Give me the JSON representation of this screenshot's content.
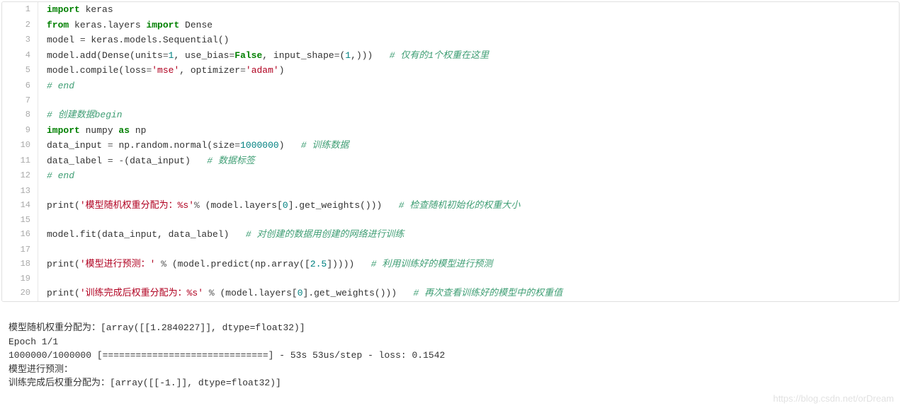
{
  "code": {
    "lines": [
      {
        "n": "1",
        "tokens": [
          {
            "t": "import",
            "c": "kw-green-bold"
          },
          {
            "t": " keras",
            "c": "name"
          }
        ]
      },
      {
        "n": "2",
        "tokens": [
          {
            "t": "from",
            "c": "kw-green-bold"
          },
          {
            "t": " keras.layers ",
            "c": "name"
          },
          {
            "t": "import",
            "c": "kw-green-bold"
          },
          {
            "t": " Dense",
            "c": "name"
          }
        ]
      },
      {
        "n": "3",
        "tokens": [
          {
            "t": "model ",
            "c": "name"
          },
          {
            "t": "=",
            "c": "operator"
          },
          {
            "t": " keras.models.Sequential()",
            "c": "name"
          }
        ]
      },
      {
        "n": "4",
        "tokens": [
          {
            "t": "model.add(Dense(units",
            "c": "name"
          },
          {
            "t": "=",
            "c": "operator"
          },
          {
            "t": "1",
            "c": "number"
          },
          {
            "t": ", use_bias",
            "c": "name"
          },
          {
            "t": "=",
            "c": "operator"
          },
          {
            "t": "False",
            "c": "bool"
          },
          {
            "t": ", input_shape",
            "c": "name"
          },
          {
            "t": "=",
            "c": "operator"
          },
          {
            "t": "(",
            "c": "name"
          },
          {
            "t": "1",
            "c": "number"
          },
          {
            "t": ",)))   ",
            "c": "name"
          },
          {
            "t": "# 仅有的1个权重在这里",
            "c": "comment"
          }
        ]
      },
      {
        "n": "5",
        "tokens": [
          {
            "t": "model.compile(loss",
            "c": "name"
          },
          {
            "t": "=",
            "c": "operator"
          },
          {
            "t": "'mse'",
            "c": "string-red"
          },
          {
            "t": ", optimizer",
            "c": "name"
          },
          {
            "t": "=",
            "c": "operator"
          },
          {
            "t": "'adam'",
            "c": "string-red"
          },
          {
            "t": ")",
            "c": "name"
          }
        ]
      },
      {
        "n": "6",
        "tokens": [
          {
            "t": "# end",
            "c": "comment"
          }
        ]
      },
      {
        "n": "7",
        "tokens": [
          {
            "t": "",
            "c": "name"
          }
        ]
      },
      {
        "n": "8",
        "tokens": [
          {
            "t": "# 创建数据begin",
            "c": "comment"
          }
        ]
      },
      {
        "n": "9",
        "tokens": [
          {
            "t": "import",
            "c": "kw-green-bold"
          },
          {
            "t": " numpy ",
            "c": "name"
          },
          {
            "t": "as",
            "c": "kw-green-bold"
          },
          {
            "t": " np",
            "c": "name"
          }
        ]
      },
      {
        "n": "10",
        "tokens": [
          {
            "t": "data_input ",
            "c": "name"
          },
          {
            "t": "=",
            "c": "operator"
          },
          {
            "t": " np.random.normal(size",
            "c": "name"
          },
          {
            "t": "=",
            "c": "operator"
          },
          {
            "t": "1000000",
            "c": "number"
          },
          {
            "t": ")   ",
            "c": "name"
          },
          {
            "t": "# 训练数据",
            "c": "comment"
          }
        ]
      },
      {
        "n": "11",
        "tokens": [
          {
            "t": "data_label ",
            "c": "name"
          },
          {
            "t": "=",
            "c": "operator"
          },
          {
            "t": " ",
            "c": "name"
          },
          {
            "t": "-",
            "c": "operator"
          },
          {
            "t": "(data_input)   ",
            "c": "name"
          },
          {
            "t": "# 数据标签",
            "c": "comment"
          }
        ]
      },
      {
        "n": "12",
        "tokens": [
          {
            "t": "# end",
            "c": "comment"
          }
        ]
      },
      {
        "n": "13",
        "tokens": [
          {
            "t": "",
            "c": "name"
          }
        ]
      },
      {
        "n": "14",
        "tokens": [
          {
            "t": "print",
            "c": "name"
          },
          {
            "t": "(",
            "c": "name"
          },
          {
            "t": "'模型随机权重分配为：%s'",
            "c": "string-red"
          },
          {
            "t": "%",
            "c": "operator"
          },
          {
            "t": " (model.layers[",
            "c": "name"
          },
          {
            "t": "0",
            "c": "number"
          },
          {
            "t": "].get_weights()))   ",
            "c": "name"
          },
          {
            "t": "# 检查随机初始化的权重大小",
            "c": "comment"
          }
        ]
      },
      {
        "n": "15",
        "tokens": [
          {
            "t": "",
            "c": "name"
          }
        ]
      },
      {
        "n": "16",
        "tokens": [
          {
            "t": "model.fit(data_input, data_label)   ",
            "c": "name"
          },
          {
            "t": "# 对创建的数据用创建的网络进行训练",
            "c": "comment"
          }
        ]
      },
      {
        "n": "17",
        "tokens": [
          {
            "t": "",
            "c": "name"
          }
        ]
      },
      {
        "n": "18",
        "tokens": [
          {
            "t": "print",
            "c": "name"
          },
          {
            "t": "(",
            "c": "name"
          },
          {
            "t": "'模型进行预测：'",
            "c": "string-red"
          },
          {
            "t": " ",
            "c": "name"
          },
          {
            "t": "%",
            "c": "operator"
          },
          {
            "t": " (model.predict(np.array([",
            "c": "name"
          },
          {
            "t": "2.5",
            "c": "number"
          },
          {
            "t": "]))))   ",
            "c": "name"
          },
          {
            "t": "# 利用训练好的模型进行预测",
            "c": "comment"
          }
        ]
      },
      {
        "n": "19",
        "tokens": [
          {
            "t": "",
            "c": "name"
          }
        ]
      },
      {
        "n": "20",
        "tokens": [
          {
            "t": "print",
            "c": "name"
          },
          {
            "t": "(",
            "c": "name"
          },
          {
            "t": "'训练完成后权重分配为：%s'",
            "c": "string-red"
          },
          {
            "t": " ",
            "c": "name"
          },
          {
            "t": "%",
            "c": "operator"
          },
          {
            "t": " (model.layers[",
            "c": "name"
          },
          {
            "t": "0",
            "c": "number"
          },
          {
            "t": "].get_weights()))   ",
            "c": "name"
          },
          {
            "t": "# 再次查看训练好的模型中的权重值",
            "c": "comment"
          }
        ]
      }
    ]
  },
  "output": {
    "line1": "模型随机权重分配为：[array([[1.2840227]], dtype=float32)]",
    "line2": "Epoch 1/1",
    "line3": "1000000/1000000 [==============================] - 53s 53us/step - loss: 0.1542",
    "line4": "模型进行预测：",
    "line5": "训练完成后权重分配为：[array([[-1.]], dtype=float32)]"
  },
  "watermark": "https://blog.csdn.net/orDream"
}
